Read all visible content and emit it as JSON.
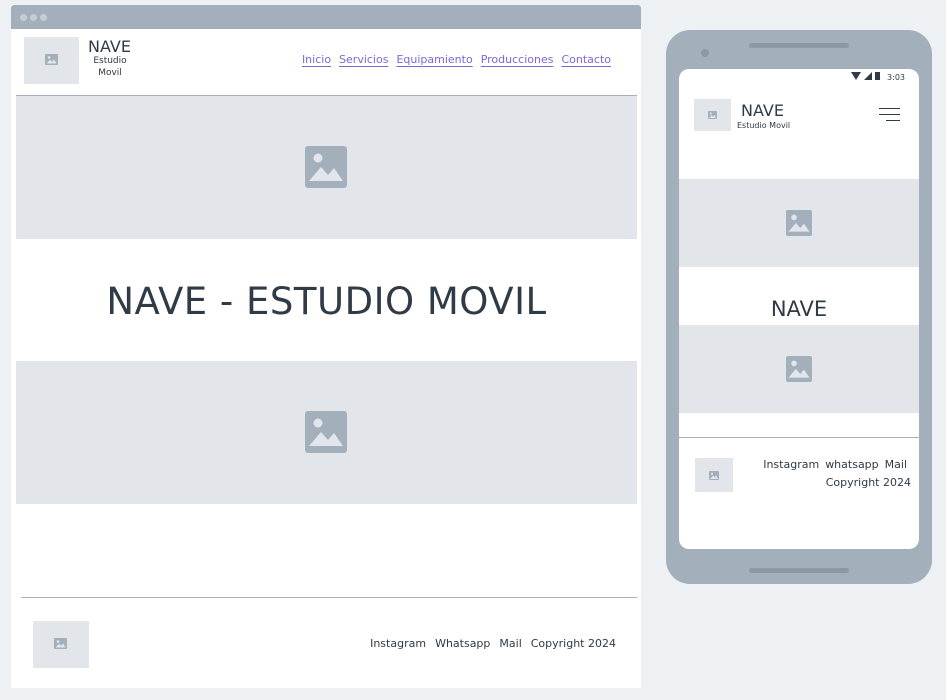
{
  "desktop": {
    "brand": {
      "name": "NAVE",
      "subtitle": "Estudio Movil"
    },
    "nav": [
      "Inicio",
      "Servicios",
      "Equipamiento",
      "Producciones",
      "Contacto"
    ],
    "hero_title": "NAVE - ESTUDIO MOVIL",
    "footer": {
      "links": [
        "Instagram",
        "Whatsapp",
        "Mail"
      ],
      "copyright": "Copyright 2024"
    }
  },
  "mobile": {
    "status_time": "3:03",
    "brand": {
      "name": "NAVE",
      "subtitle": "Estudio Movil"
    },
    "hero_title": "NAVE",
    "footer": {
      "links": [
        "Instagram",
        "whatsapp",
        "Mail"
      ],
      "copyright": "Copyright 2024"
    }
  },
  "icons": {
    "image_placeholder": "image-placeholder-icon",
    "menu": "hamburger-menu-icon",
    "wifi": "wifi-icon",
    "signal": "cell-signal-icon",
    "battery": "battery-icon"
  },
  "colors": {
    "frame": "#a3b0bc",
    "placeholder_bg": "#e2e6eb",
    "placeholder_icon": "#a3b0bc",
    "text": "#2f3b47",
    "link": "#7f66d6",
    "page_bg": "#eef1f4"
  }
}
